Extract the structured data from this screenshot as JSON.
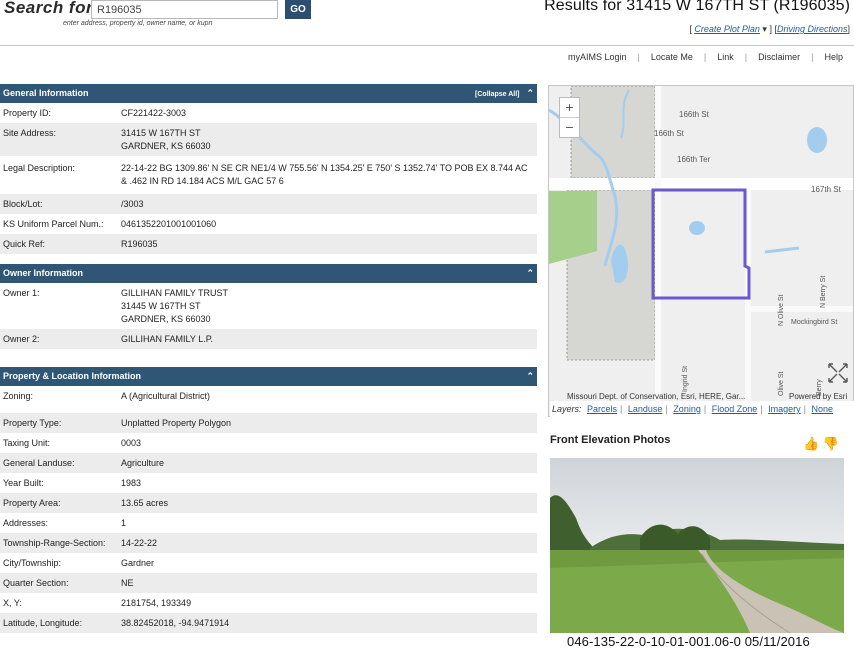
{
  "search": {
    "label": "Search for:",
    "value": "R196035",
    "hint": "enter address, property id, owner name, or kupn",
    "go_label": "GO"
  },
  "results": {
    "title": "Results for 31415 W 167TH ST (R196035)",
    "create_plot_plan": "Create Plot Plan",
    "driving_directions": "Driving Directions"
  },
  "nav": [
    "myAIMS Login",
    "Locate Me",
    "Link",
    "Disclaimer",
    "Help"
  ],
  "general": {
    "title": "General Information",
    "collapse_label": "[Collapse All]",
    "rows": [
      {
        "label": "Property ID:",
        "value": "CF221422-3003"
      },
      {
        "label": "Site Address:",
        "value": "31415 W 167TH ST",
        "value2": "GARDNER, KS 66030"
      },
      {
        "label": "Legal Description:",
        "value": "22-14-22 BG 1309.86' N SE CR NE1/4 W 755.56' N 1354.25' E 750' S 1352.74' TO POB EX 8.744 AC & .462 IN RD 14.184 ACS M/L GAC 57 6"
      },
      {
        "label": "Block/Lot:",
        "value": "/3003"
      },
      {
        "label": "KS Uniform Parcel Num.:",
        "value": "0461352201001001060"
      },
      {
        "label": "Quick Ref:",
        "value": "R196035"
      }
    ]
  },
  "owner": {
    "title": "Owner Information",
    "rows": [
      {
        "label": "Owner 1:",
        "value": "GILLIHAN FAMILY TRUST",
        "value2": "31445 W 167TH ST",
        "value3": "GARDNER, KS 66030"
      },
      {
        "label": "Owner 2:",
        "value": "GILLIHAN FAMILY L.P."
      }
    ]
  },
  "property": {
    "title": "Property & Location Information",
    "rows": [
      {
        "label": "Zoning:",
        "value": "A (Agricultural District)"
      },
      {
        "label": "Property Type:",
        "value": "Unplatted Property Polygon"
      },
      {
        "label": "Taxing Unit:",
        "value": "0003"
      },
      {
        "label": "General Landuse:",
        "value": "Agriculture"
      },
      {
        "label": "Year Built:",
        "value": "1983"
      },
      {
        "label": "Property Area:",
        "value": "13.65 acres"
      },
      {
        "label": "Addresses:",
        "value": "1"
      },
      {
        "label": "Township-Range-Section:",
        "value": "14-22-22"
      },
      {
        "label": "City/Township:",
        "value": "Gardner"
      },
      {
        "label": "Quarter Section:",
        "value": "NE"
      },
      {
        "label": "X, Y:",
        "value": "2181754, 193349"
      },
      {
        "label": "Latitude, Longitude:",
        "value": "38.82452018, -94.9471914"
      }
    ]
  },
  "map": {
    "streets": {
      "s1": "166th St",
      "s2": "166th St",
      "s3": "166th Ter",
      "s4": "167th St",
      "s5": "N Olive St",
      "s6": "N Berry St",
      "s7": "Mockingbird St",
      "s8": "Ingrid St",
      "s9": "Olive St",
      "s10": "Berry"
    },
    "attribution": "Missouri Dept. of Conservation, Esri, HERE, Gar...",
    "powered_by": "Powered by Esri",
    "layers_label": "Layers:",
    "layers": [
      "Parcels",
      "Landuse",
      "Zoning",
      "Flood Zone",
      "Imagery",
      "None"
    ],
    "colors": {
      "parcel_outline": "#6a5acd",
      "water": "#a3cdef",
      "green": "#a5cf8a"
    }
  },
  "photos": {
    "title": "Front Elevation Photos",
    "caption": "046-135-22-0-10-01-001.06-0  05/11/2016"
  }
}
